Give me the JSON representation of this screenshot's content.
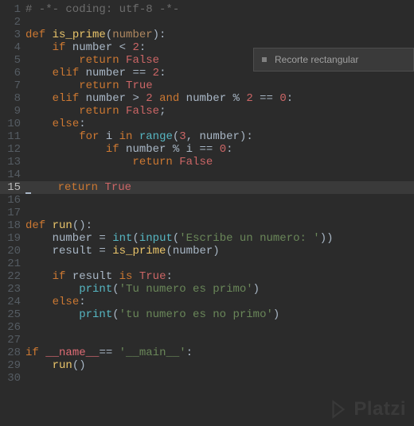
{
  "editor": {
    "current_line": 15,
    "lines": [
      {
        "n": 1,
        "tokens": [
          [
            "comment",
            "# -*- coding: utf-8 -*-"
          ]
        ]
      },
      {
        "n": 2,
        "tokens": []
      },
      {
        "n": 3,
        "tokens": [
          [
            "kw",
            "def "
          ],
          [
            "fn",
            "is_prime"
          ],
          [
            "op",
            "("
          ],
          [
            "param",
            "number"
          ],
          [
            "op",
            "):"
          ]
        ]
      },
      {
        "n": 4,
        "tokens": [
          [
            "plain",
            "    "
          ],
          [
            "kw",
            "if"
          ],
          [
            "plain",
            " number "
          ],
          [
            "op",
            "<"
          ],
          [
            "plain",
            " "
          ],
          [
            "num",
            "2"
          ],
          [
            "op",
            ":"
          ]
        ]
      },
      {
        "n": 5,
        "tokens": [
          [
            "plain",
            "        "
          ],
          [
            "kw",
            "return"
          ],
          [
            "plain",
            " "
          ],
          [
            "bool",
            "False"
          ]
        ]
      },
      {
        "n": 6,
        "tokens": [
          [
            "plain",
            "    "
          ],
          [
            "kw",
            "elif"
          ],
          [
            "plain",
            " number "
          ],
          [
            "op",
            "=="
          ],
          [
            "plain",
            " "
          ],
          [
            "num",
            "2"
          ],
          [
            "op",
            ":"
          ]
        ]
      },
      {
        "n": 7,
        "tokens": [
          [
            "plain",
            "        "
          ],
          [
            "kw",
            "return"
          ],
          [
            "plain",
            " "
          ],
          [
            "bool",
            "True"
          ]
        ]
      },
      {
        "n": 8,
        "tokens": [
          [
            "plain",
            "    "
          ],
          [
            "kw",
            "elif"
          ],
          [
            "plain",
            " number "
          ],
          [
            "op",
            ">"
          ],
          [
            "plain",
            " "
          ],
          [
            "num",
            "2"
          ],
          [
            "plain",
            " "
          ],
          [
            "kw",
            "and"
          ],
          [
            "plain",
            " number "
          ],
          [
            "op",
            "%"
          ],
          [
            "plain",
            " "
          ],
          [
            "num",
            "2"
          ],
          [
            "plain",
            " "
          ],
          [
            "op",
            "=="
          ],
          [
            "plain",
            " "
          ],
          [
            "num",
            "0"
          ],
          [
            "op",
            ":"
          ]
        ]
      },
      {
        "n": 9,
        "tokens": [
          [
            "plain",
            "        "
          ],
          [
            "kw",
            "return"
          ],
          [
            "plain",
            " "
          ],
          [
            "bool",
            "False"
          ],
          [
            "semi",
            ";"
          ]
        ]
      },
      {
        "n": 10,
        "tokens": [
          [
            "plain",
            "    "
          ],
          [
            "kw",
            "else"
          ],
          [
            "op",
            ":"
          ]
        ]
      },
      {
        "n": 11,
        "tokens": [
          [
            "plain",
            "        "
          ],
          [
            "kw",
            "for"
          ],
          [
            "plain",
            " i "
          ],
          [
            "kw",
            "in"
          ],
          [
            "plain",
            " "
          ],
          [
            "builtin",
            "range"
          ],
          [
            "op",
            "("
          ],
          [
            "num",
            "3"
          ],
          [
            "op",
            ","
          ],
          [
            "plain",
            " number"
          ],
          [
            "op",
            "):"
          ]
        ]
      },
      {
        "n": 12,
        "tokens": [
          [
            "plain",
            "            "
          ],
          [
            "kw",
            "if"
          ],
          [
            "plain",
            " number "
          ],
          [
            "op",
            "%"
          ],
          [
            "plain",
            " i "
          ],
          [
            "op",
            "=="
          ],
          [
            "plain",
            " "
          ],
          [
            "num",
            "0"
          ],
          [
            "op",
            ":"
          ]
        ]
      },
      {
        "n": 13,
        "tokens": [
          [
            "plain",
            "                "
          ],
          [
            "kw",
            "return"
          ],
          [
            "plain",
            " "
          ],
          [
            "bool",
            "False"
          ]
        ]
      },
      {
        "n": 14,
        "tokens": []
      },
      {
        "n": 15,
        "tokens": [
          [
            "plain",
            "    "
          ],
          [
            "kw",
            "return"
          ],
          [
            "plain",
            " "
          ],
          [
            "bool",
            "True"
          ]
        ],
        "cursor_before": true
      },
      {
        "n": 16,
        "tokens": []
      },
      {
        "n": 17,
        "tokens": []
      },
      {
        "n": 18,
        "tokens": [
          [
            "kw",
            "def "
          ],
          [
            "fn",
            "run"
          ],
          [
            "op",
            "():"
          ]
        ]
      },
      {
        "n": 19,
        "tokens": [
          [
            "plain",
            "    number "
          ],
          [
            "op",
            "="
          ],
          [
            "plain",
            " "
          ],
          [
            "builtin",
            "int"
          ],
          [
            "op",
            "("
          ],
          [
            "builtin",
            "input"
          ],
          [
            "op",
            "("
          ],
          [
            "string",
            "'Escribe un numero: '"
          ],
          [
            "op",
            "))"
          ]
        ]
      },
      {
        "n": 20,
        "tokens": [
          [
            "plain",
            "    result "
          ],
          [
            "op",
            "="
          ],
          [
            "plain",
            " "
          ],
          [
            "fn",
            "is_prime"
          ],
          [
            "op",
            "("
          ],
          [
            "plain",
            "number"
          ],
          [
            "op",
            ")"
          ]
        ]
      },
      {
        "n": 21,
        "tokens": []
      },
      {
        "n": 22,
        "tokens": [
          [
            "plain",
            "    "
          ],
          [
            "kw",
            "if"
          ],
          [
            "plain",
            " result "
          ],
          [
            "kw",
            "is"
          ],
          [
            "plain",
            " "
          ],
          [
            "bool",
            "True"
          ],
          [
            "op",
            ":"
          ]
        ]
      },
      {
        "n": 23,
        "tokens": [
          [
            "plain",
            "        "
          ],
          [
            "builtin",
            "print"
          ],
          [
            "op",
            "("
          ],
          [
            "string",
            "'Tu numero es primo'"
          ],
          [
            "op",
            ")"
          ]
        ]
      },
      {
        "n": 24,
        "tokens": [
          [
            "plain",
            "    "
          ],
          [
            "kw",
            "else"
          ],
          [
            "op",
            ":"
          ]
        ]
      },
      {
        "n": 25,
        "tokens": [
          [
            "plain",
            "        "
          ],
          [
            "builtin",
            "print"
          ],
          [
            "op",
            "("
          ],
          [
            "string",
            "'tu numero es no primo'"
          ],
          [
            "op",
            ")"
          ]
        ]
      },
      {
        "n": 26,
        "tokens": []
      },
      {
        "n": 27,
        "tokens": []
      },
      {
        "n": 28,
        "tokens": [
          [
            "kw",
            "if"
          ],
          [
            "plain",
            " "
          ],
          [
            "name",
            "__name__"
          ],
          [
            "op",
            "=="
          ],
          [
            "plain",
            " "
          ],
          [
            "string",
            "'__main__'"
          ],
          [
            "op",
            ":"
          ]
        ]
      },
      {
        "n": 29,
        "tokens": [
          [
            "plain",
            "    "
          ],
          [
            "fn",
            "run"
          ],
          [
            "op",
            "()"
          ]
        ]
      },
      {
        "n": 30,
        "tokens": []
      }
    ]
  },
  "overlay": {
    "label": "Recorte rectangular"
  },
  "watermark": {
    "text": "Platzi"
  }
}
